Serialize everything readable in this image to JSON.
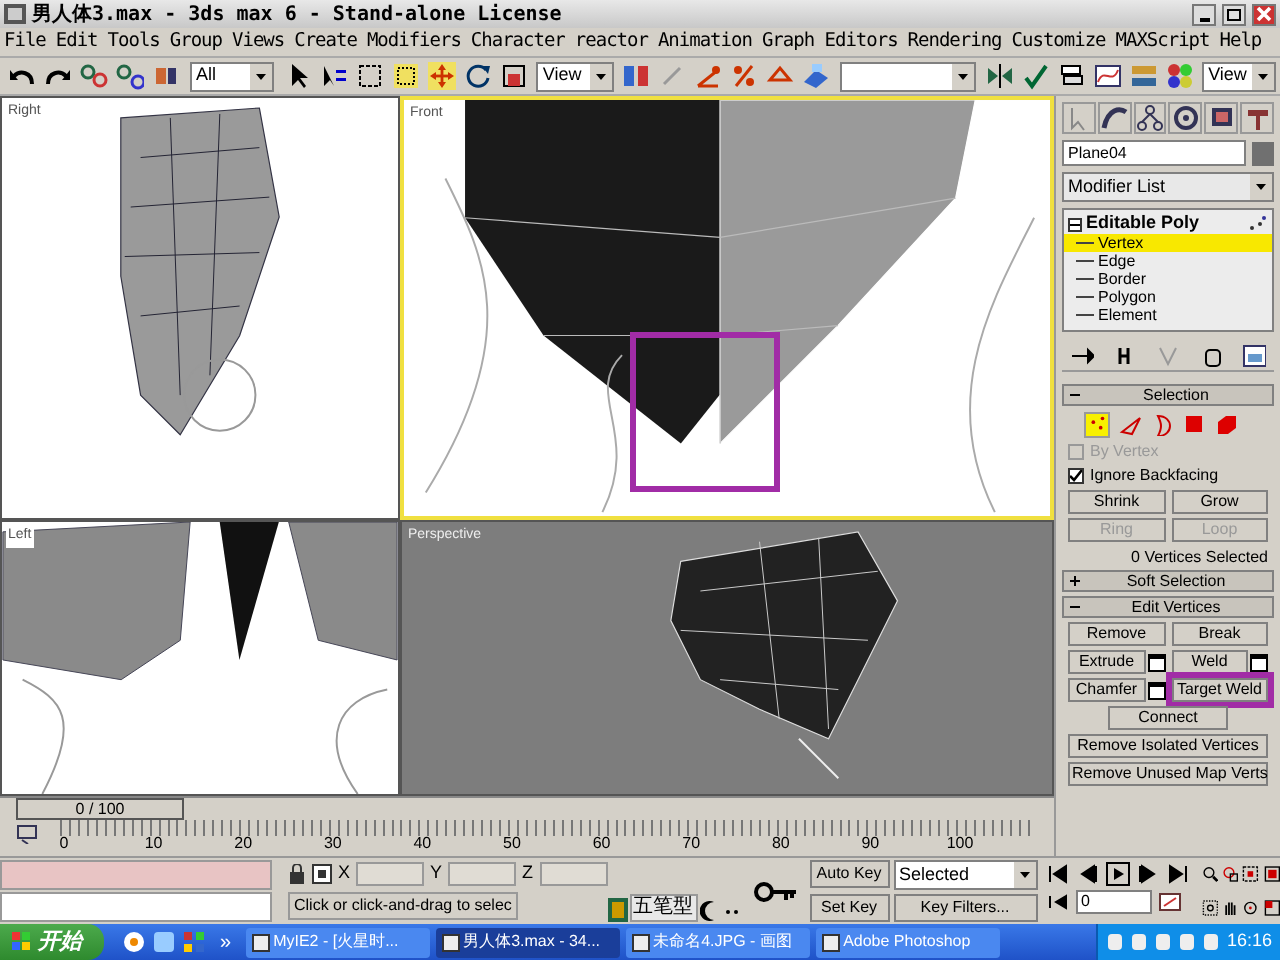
{
  "window": {
    "title": "男人体3.max - 3ds max 6 - Stand-alone License"
  },
  "menu": [
    "File",
    "Edit",
    "Tools",
    "Group",
    "Views",
    "Create",
    "Modifiers",
    "Character",
    "reactor",
    "Animation",
    "Graph Editors",
    "Rendering",
    "Customize",
    "MAXScript",
    "Help"
  ],
  "toolbar": {
    "selection_filter": "All",
    "reference_coordinates": "View",
    "view_dropdown": "View"
  },
  "viewports": [
    {
      "label": "Right",
      "kind": "right",
      "active": false,
      "highlighted": false
    },
    {
      "label": "Front",
      "kind": "front",
      "active": true,
      "highlighted": true
    },
    {
      "label": "Left",
      "kind": "left",
      "active": false,
      "highlighted": false
    },
    {
      "label": "Perspective",
      "kind": "perspective",
      "active": false,
      "highlighted": false
    }
  ],
  "command_panel": {
    "object_name": "Plane04",
    "modifier_list": "Modifier List",
    "stack": [
      {
        "label": "Editable Poly",
        "expanded": true,
        "children": [
          {
            "label": "Vertex",
            "selected": true
          },
          {
            "label": "Edge",
            "selected": false
          },
          {
            "label": "Border",
            "selected": false
          },
          {
            "label": "Polygon",
            "selected": false
          },
          {
            "label": "Element",
            "selected": false
          }
        ]
      }
    ],
    "rollouts": [
      {
        "kind": "selection",
        "title": "Selection",
        "expanded": true,
        "subobjects": [
          {
            "selected": true
          },
          {
            "selected": false
          },
          {
            "selected": false
          },
          {
            "selected": false
          },
          {
            "selected": false
          }
        ],
        "checkboxes": [
          {
            "label": "By Vertex",
            "checked": false,
            "disabled": true
          },
          {
            "label": "Ignore Backfacing",
            "checked": true,
            "disabled": false
          }
        ],
        "buttons": [
          {
            "label": "Shrink",
            "disabled": false
          },
          {
            "label": "Grow",
            "disabled": false
          },
          {
            "label": "Ring",
            "disabled": true
          },
          {
            "label": "Loop",
            "disabled": true
          }
        ],
        "status": "0 Vertices Selected"
      },
      {
        "title": "Soft Selection",
        "expanded": false
      },
      {
        "kind": "edit",
        "title": "Edit Vertices",
        "expanded": true,
        "rows": [
          [
            {
              "label": "Remove",
              "settings": false,
              "highlighted": false
            },
            {
              "label": "Break",
              "settings": false,
              "highlighted": false
            }
          ],
          [
            {
              "label": "Extrude",
              "settings": true,
              "highlighted": false
            },
            {
              "label": "Weld",
              "settings": true,
              "highlighted": false
            }
          ],
          [
            {
              "label": "Chamfer",
              "settings": true,
              "highlighted": false
            },
            {
              "label": "Target Weld",
              "settings": false,
              "highlighted": true
            }
          ],
          [
            {
              "label": "Connect",
              "settings": false,
              "highlighted": false
            }
          ],
          [
            {
              "label": "Remove Isolated Vertices",
              "settings": false,
              "highlighted": false
            }
          ],
          [
            {
              "label": "Remove Unused Map Verts",
              "settings": false,
              "highlighted": false
            }
          ]
        ]
      }
    ]
  },
  "time_slider": {
    "label": "0 / 100",
    "level": 0
  },
  "track_ticks": [
    "0",
    "10",
    "20",
    "30",
    "40",
    "50",
    "60",
    "70",
    "80",
    "90",
    "100"
  ],
  "status_bar": {
    "prompt": "Click or click-and-drag to selec",
    "coordinates": [
      "X",
      "Y",
      "Z"
    ],
    "ime": "五笔型",
    "auto_key": "Auto Key",
    "key_mode": "Selected",
    "set_key": "Set Key",
    "key_filters": "Key Filters...",
    "frame": "0"
  },
  "taskbar": {
    "start": "开始",
    "overflow": "»",
    "tasks": [
      {
        "label": "MyIE2 - [火星时...",
        "selected": false
      },
      {
        "label": "男人体3.max - 34...",
        "selected": true
      },
      {
        "label": "未命名4.JPG - 画图",
        "selected": false
      },
      {
        "label": "Adobe Photoshop",
        "selected": false
      }
    ],
    "clock": "16:16"
  }
}
